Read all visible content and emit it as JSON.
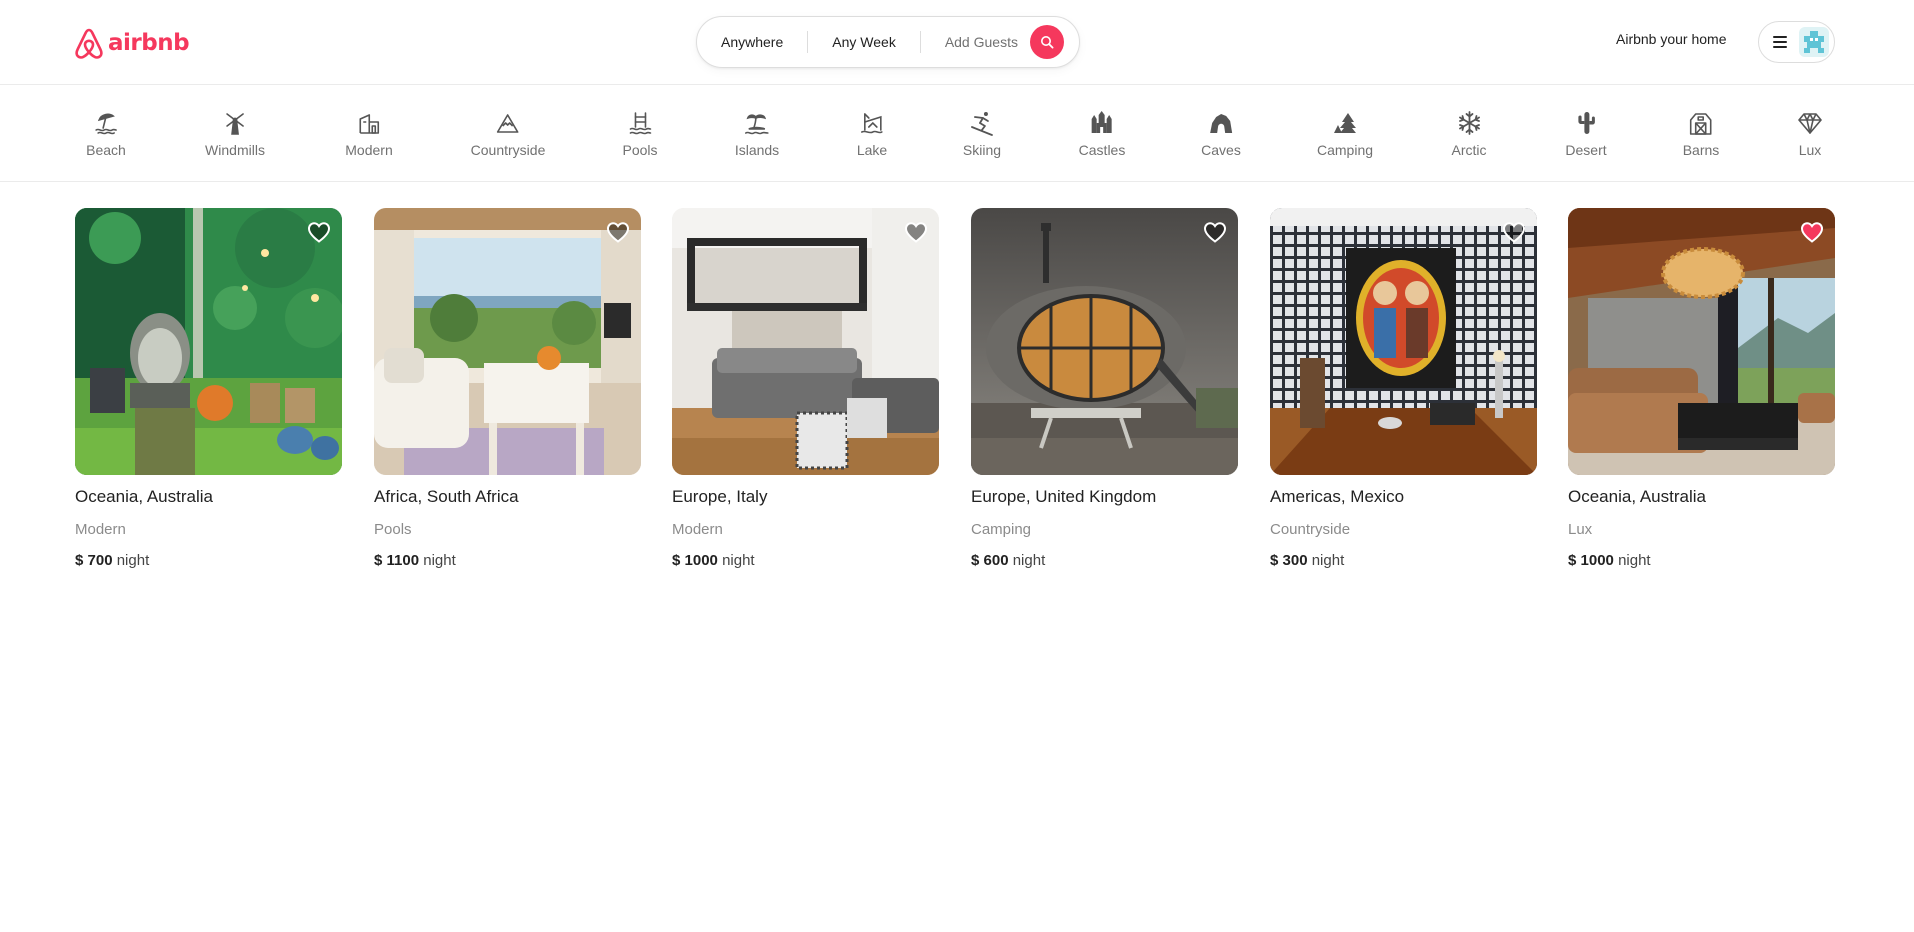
{
  "header": {
    "logo_text": "airbnb",
    "search": {
      "where": "Anywhere",
      "when": "Any Week",
      "guests": "Add Guests"
    },
    "host_link": "Airbnb your home"
  },
  "categories": [
    {
      "label": "Beach",
      "icon": "beach-icon"
    },
    {
      "label": "Windmills",
      "icon": "windmill-icon"
    },
    {
      "label": "Modern",
      "icon": "modern-house-icon"
    },
    {
      "label": "Countryside",
      "icon": "mountain-icon"
    },
    {
      "label": "Pools",
      "icon": "pool-icon"
    },
    {
      "label": "Islands",
      "icon": "island-icon"
    },
    {
      "label": "Lake",
      "icon": "lake-icon"
    },
    {
      "label": "Skiing",
      "icon": "skiing-icon"
    },
    {
      "label": "Castles",
      "icon": "castle-icon"
    },
    {
      "label": "Caves",
      "icon": "cave-icon"
    },
    {
      "label": "Camping",
      "icon": "camping-icon"
    },
    {
      "label": "Arctic",
      "icon": "snowflake-icon"
    },
    {
      "label": "Desert",
      "icon": "cactus-icon"
    },
    {
      "label": "Barns",
      "icon": "barn-icon"
    },
    {
      "label": "Lux",
      "icon": "diamond-icon"
    }
  ],
  "listings": [
    {
      "location": "Oceania, Australia",
      "category": "Modern",
      "price": "$ 700",
      "unit": "night",
      "favorited": false
    },
    {
      "location": "Africa, South Africa",
      "category": "Pools",
      "price": "$ 1100",
      "unit": "night",
      "favorited": false
    },
    {
      "location": "Europe, Italy",
      "category": "Modern",
      "price": "$ 1000",
      "unit": "night",
      "favorited": false
    },
    {
      "location": "Europe, United Kingdom",
      "category": "Camping",
      "price": "$ 600",
      "unit": "night",
      "favorited": false
    },
    {
      "location": "Americas, Mexico",
      "category": "Countryside",
      "price": "$ 300",
      "unit": "night",
      "favorited": false
    },
    {
      "location": "Oceania, Australia",
      "category": "Lux",
      "price": "$ 1000",
      "unit": "night",
      "favorited": true
    }
  ],
  "colors": {
    "brand": "#f5385d",
    "muted_text": "#717171",
    "border": "#dddddd"
  }
}
